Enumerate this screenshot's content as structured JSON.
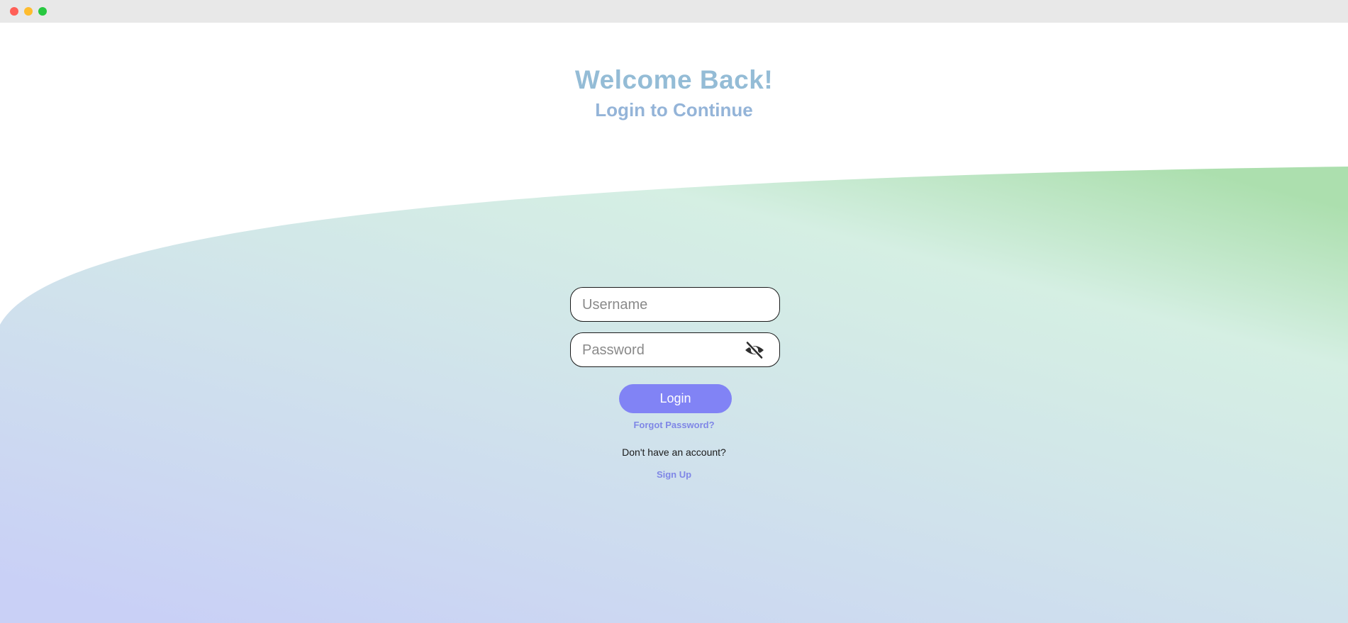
{
  "window": {
    "controls": [
      "close",
      "minimize",
      "maximize"
    ]
  },
  "header": {
    "title": "Welcome Back!",
    "subtitle": "Login to Continue"
  },
  "form": {
    "username_placeholder": "Username",
    "password_placeholder": "Password",
    "password_toggle_icon": "eye-slash-icon",
    "login_label": "Login",
    "forgot_label": "Forgot Password?",
    "no_account_text": "Don't have an account?",
    "signup_label": "Sign Up"
  },
  "colors": {
    "title": "#94bcd6",
    "subtitle": "#94b4d8",
    "button": "#8183f5",
    "link": "#7f87e6",
    "gradient_green": "#b0e2b2",
    "gradient_mint": "#d4eee4",
    "gradient_lavender": "#c9d0f6"
  }
}
